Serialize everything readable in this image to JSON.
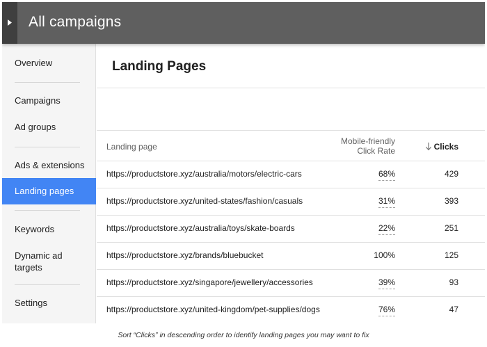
{
  "header": {
    "title": "All campaigns",
    "toggle_icon": "triangle-right-icon"
  },
  "sidebar": {
    "items": [
      {
        "label": "Overview"
      },
      {
        "label": "Campaigns"
      },
      {
        "label": "Ad groups"
      },
      {
        "label": "Ads & extensions"
      },
      {
        "label": "Landing pages",
        "active": true
      },
      {
        "label": "Keywords"
      },
      {
        "label": "Dynamic ad targets"
      },
      {
        "label": "Settings"
      }
    ]
  },
  "main": {
    "title": "Landing Pages",
    "table": {
      "columns": {
        "landing_page": "Landing page",
        "mobile_line1": "Mobile-friendly",
        "mobile_line2": "Click Rate",
        "clicks": "Clicks",
        "sort_icon": "arrow-down-icon",
        "sort": "descending"
      },
      "rows": [
        {
          "url": "https://productstore.xyz/australia/motors/electric-cars",
          "rate": "68%",
          "clicks": "429"
        },
        {
          "url": "https://productstore.xyz/united-states/fashion/casuals",
          "rate": "31%",
          "clicks": "393"
        },
        {
          "url": "https://productstore.xyz/australia/toys/skate-boards",
          "rate": "22%",
          "clicks": "251"
        },
        {
          "url": "https://productstore.xyz/brands/bluebucket",
          "rate": "100%",
          "clicks": "125"
        },
        {
          "url": "https://productstore.xyz/singapore/jewellery/accessories",
          "rate": "39%",
          "clicks": "93"
        },
        {
          "url": "https://productstore.xyz/united-kingdom/pet-supplies/dogs",
          "rate": "76%",
          "clicks": "47"
        }
      ]
    }
  },
  "caption": "Sort “Clicks” in descending order to identify landing pages you may want to fix",
  "colors": {
    "header_bg": "#5f5f5f",
    "toggle_bg": "#3f3f3f",
    "active_nav": "#4285f4",
    "sidebar_bg": "#f5f5f5"
  }
}
